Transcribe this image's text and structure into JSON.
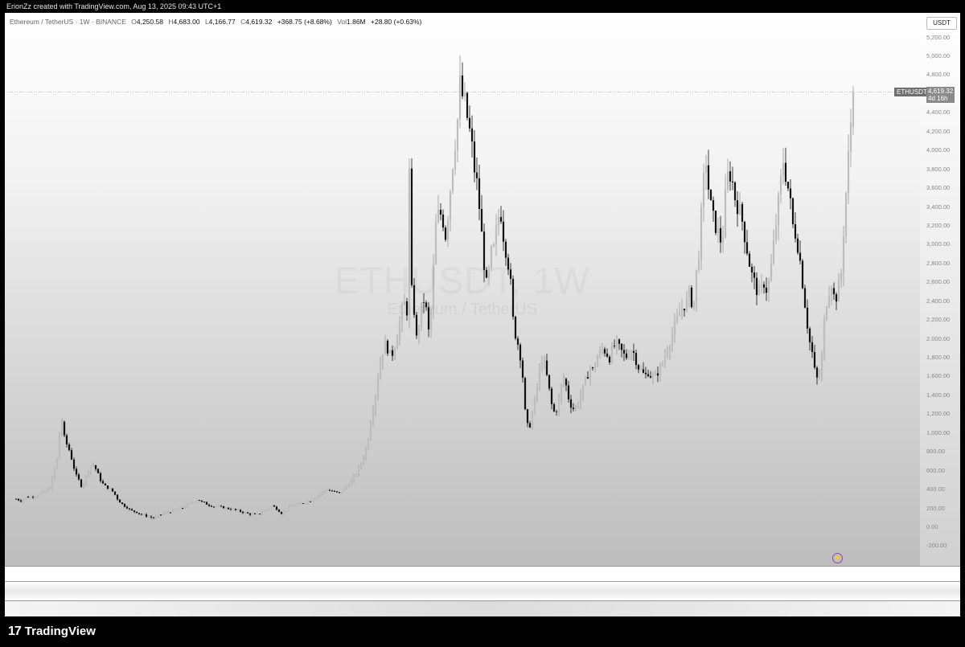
{
  "header": {
    "caption": "ErionZz created with TradingView.com, Aug 13, 2025 09:43 UTC+1"
  },
  "legend": {
    "symbol": "Ethereum / TetherUS · 1W · BINANCE",
    "o_label": "O",
    "o": "4,250.58",
    "h_label": "H",
    "h": "4,683.00",
    "l_label": "L",
    "l": "4,166.77",
    "c_label": "C",
    "c": "4,619.32",
    "change": "+368.75 (+8.68%)",
    "vol_label": "Vol",
    "vol": "1.86M",
    "vol_change": "+28.80 (+0.63%)"
  },
  "watermark": {
    "line1": "ETHUSDT, 1W",
    "line2": "Ethereum / TetherUS"
  },
  "price_scale": {
    "unit": "USDT",
    "ticks": [
      "5,200.00",
      "5,000.00",
      "4,800.00",
      "4,400.00",
      "4,200.00",
      "4,000.00",
      "3,800.00",
      "3,600.00",
      "3,400.00",
      "3,200.00",
      "3,000.00",
      "2,800.00",
      "2,600.00",
      "2,400.00",
      "2,200.00",
      "2,000.00",
      "1,800.00",
      "1,600.00",
      "1,400.00",
      "1,200.00",
      "1,000.00",
      "800.00",
      "600.00",
      "400.00",
      "200.00",
      "0.00",
      "-200.00"
    ],
    "current_symbol": "ETHUSDT",
    "current_price": "4,619.32",
    "countdown": "4d 16h"
  },
  "branding": {
    "logo": "17",
    "name": "TradingView"
  },
  "chart_data": {
    "type": "candlestick",
    "symbol": "ETHUSDT",
    "interval": "1W",
    "ylim": [
      -200,
      5300
    ],
    "last": {
      "open": 4250.58,
      "high": 4683.0,
      "low": 4166.77,
      "close": 4619.32
    },
    "price_path": [
      [
        0,
        300
      ],
      [
        6,
        280
      ],
      [
        12,
        320
      ],
      [
        18,
        320
      ],
      [
        24,
        330
      ],
      [
        30,
        350
      ],
      [
        36,
        380
      ],
      [
        42,
        420
      ],
      [
        48,
        620
      ],
      [
        52,
        760
      ],
      [
        56,
        1250
      ],
      [
        58,
        1000
      ],
      [
        62,
        900
      ],
      [
        66,
        820
      ],
      [
        70,
        700
      ],
      [
        74,
        560
      ],
      [
        78,
        500
      ],
      [
        82,
        420
      ],
      [
        86,
        520
      ],
      [
        90,
        600
      ],
      [
        94,
        680
      ],
      [
        98,
        640
      ],
      [
        102,
        560
      ],
      [
        106,
        480
      ],
      [
        110,
        440
      ],
      [
        114,
        420
      ],
      [
        118,
        400
      ],
      [
        122,
        360
      ],
      [
        126,
        300
      ],
      [
        130,
        260
      ],
      [
        134,
        230
      ],
      [
        138,
        210
      ],
      [
        142,
        180
      ],
      [
        146,
        170
      ],
      [
        150,
        160
      ],
      [
        154,
        140
      ],
      [
        158,
        130
      ],
      [
        162,
        120
      ],
      [
        166,
        110
      ],
      [
        170,
        100
      ],
      [
        174,
        110
      ],
      [
        178,
        130
      ],
      [
        182,
        140
      ],
      [
        186,
        150
      ],
      [
        190,
        160
      ],
      [
        194,
        170
      ],
      [
        198,
        180
      ],
      [
        202,
        190
      ],
      [
        206,
        200
      ],
      [
        210,
        220
      ],
      [
        214,
        240
      ],
      [
        218,
        260
      ],
      [
        222,
        280
      ],
      [
        226,
        300
      ],
      [
        230,
        270
      ],
      [
        234,
        260
      ],
      [
        238,
        240
      ],
      [
        242,
        230
      ],
      [
        246,
        220
      ],
      [
        250,
        220
      ],
      [
        254,
        215
      ],
      [
        258,
        210
      ],
      [
        262,
        200
      ],
      [
        266,
        195
      ],
      [
        270,
        190
      ],
      [
        274,
        180
      ],
      [
        278,
        170
      ],
      [
        282,
        160
      ],
      [
        286,
        150
      ],
      [
        290,
        140
      ],
      [
        294,
        140
      ],
      [
        298,
        130
      ],
      [
        302,
        140
      ],
      [
        306,
        160
      ],
      [
        310,
        180
      ],
      [
        314,
        200
      ],
      [
        318,
        230
      ],
      [
        322,
        210
      ],
      [
        326,
        180
      ],
      [
        330,
        150
      ],
      [
        334,
        170
      ],
      [
        338,
        200
      ],
      [
        342,
        220
      ],
      [
        346,
        230
      ],
      [
        350,
        240
      ],
      [
        354,
        250
      ],
      [
        358,
        260
      ],
      [
        362,
        270
      ],
      [
        366,
        280
      ],
      [
        370,
        300
      ],
      [
        374,
        330
      ],
      [
        378,
        350
      ],
      [
        382,
        380
      ],
      [
        386,
        400
      ],
      [
        390,
        390
      ],
      [
        394,
        380
      ],
      [
        398,
        370
      ],
      [
        402,
        360
      ],
      [
        406,
        390
      ],
      [
        410,
        420
      ],
      [
        414,
        460
      ],
      [
        418,
        500
      ],
      [
        422,
        560
      ],
      [
        426,
        620
      ],
      [
        430,
        700
      ],
      [
        434,
        800
      ],
      [
        438,
        950
      ],
      [
        442,
        1200
      ],
      [
        446,
        1350
      ],
      [
        450,
        1600
      ],
      [
        454,
        1800
      ],
      [
        458,
        1950
      ],
      [
        462,
        1900
      ],
      [
        466,
        1800
      ],
      [
        470,
        1900
      ],
      [
        474,
        2050
      ],
      [
        478,
        2200
      ],
      [
        482,
        2400
      ],
      [
        486,
        2300
      ],
      [
        488,
        3500
      ],
      [
        490,
        4000
      ],
      [
        492,
        2500
      ],
      [
        494,
        2400
      ],
      [
        498,
        2000
      ],
      [
        502,
        2200
      ],
      [
        506,
        2450
      ],
      [
        510,
        2300
      ],
      [
        514,
        2000
      ],
      [
        518,
        2600
      ],
      [
        522,
        3200
      ],
      [
        526,
        3350
      ],
      [
        530,
        3300
      ],
      [
        534,
        3100
      ],
      [
        538,
        3400
      ],
      [
        542,
        3800
      ],
      [
        546,
        4100
      ],
      [
        550,
        4400
      ],
      [
        552,
        4700
      ],
      [
        554,
        4600
      ],
      [
        558,
        4500
      ],
      [
        562,
        4300
      ],
      [
        566,
        4100
      ],
      [
        570,
        3800
      ],
      [
        574,
        3600
      ],
      [
        578,
        3200
      ],
      [
        582,
        2800
      ],
      [
        586,
        2500
      ],
      [
        590,
        2900
      ],
      [
        594,
        2950
      ],
      [
        598,
        3200
      ],
      [
        602,
        3400
      ],
      [
        606,
        3100
      ],
      [
        610,
        2900
      ],
      [
        614,
        2700
      ],
      [
        618,
        2200
      ],
      [
        622,
        2000
      ],
      [
        626,
        1900
      ],
      [
        630,
        1600
      ],
      [
        634,
        1100
      ],
      [
        638,
        1050
      ],
      [
        642,
        1200
      ],
      [
        646,
        1400
      ],
      [
        650,
        1600
      ],
      [
        654,
        1800
      ],
      [
        658,
        1700
      ],
      [
        662,
        1500
      ],
      [
        666,
        1300
      ],
      [
        670,
        1200
      ],
      [
        674,
        1300
      ],
      [
        678,
        1500
      ],
      [
        682,
        1600
      ],
      [
        686,
        1400
      ],
      [
        690,
        1300
      ],
      [
        694,
        1250
      ],
      [
        698,
        1300
      ],
      [
        702,
        1400
      ],
      [
        706,
        1500
      ],
      [
        710,
        1600
      ],
      [
        714,
        1700
      ],
      [
        718,
        1650
      ],
      [
        722,
        1800
      ],
      [
        726,
        1850
      ],
      [
        730,
        1900
      ],
      [
        734,
        1850
      ],
      [
        738,
        1800
      ],
      [
        742,
        1900
      ],
      [
        746,
        1950
      ],
      [
        750,
        1900
      ],
      [
        754,
        1850
      ],
      [
        758,
        1800
      ],
      [
        762,
        1850
      ],
      [
        766,
        1900
      ],
      [
        770,
        1800
      ],
      [
        774,
        1700
      ],
      [
        778,
        1650
      ],
      [
        782,
        1600
      ],
      [
        786,
        1650
      ],
      [
        790,
        1600
      ],
      [
        794,
        1580
      ],
      [
        798,
        1650
      ],
      [
        802,
        1700
      ],
      [
        806,
        1800
      ],
      [
        810,
        1900
      ],
      [
        814,
        2000
      ],
      [
        818,
        2100
      ],
      [
        822,
        2200
      ],
      [
        826,
        2300
      ],
      [
        830,
        2350
      ],
      [
        834,
        2400
      ],
      [
        838,
        2500
      ],
      [
        842,
        2300
      ],
      [
        846,
        2700
      ],
      [
        850,
        3000
      ],
      [
        854,
        3600
      ],
      [
        858,
        3900
      ],
      [
        862,
        3500
      ],
      [
        866,
        3300
      ],
      [
        870,
        3200
      ],
      [
        874,
        3100
      ],
      [
        878,
        3000
      ],
      [
        882,
        3500
      ],
      [
        886,
        3800
      ],
      [
        890,
        3700
      ],
      [
        894,
        3500
      ],
      [
        898,
        3400
      ],
      [
        902,
        3300
      ],
      [
        906,
        3100
      ],
      [
        910,
        2900
      ],
      [
        914,
        2700
      ],
      [
        918,
        2600
      ],
      [
        922,
        2500
      ],
      [
        926,
        2500
      ],
      [
        930,
        2600
      ],
      [
        934,
        2500
      ],
      [
        938,
        2700
      ],
      [
        942,
        3000
      ],
      [
        946,
        3300
      ],
      [
        950,
        3600
      ],
      [
        954,
        3900
      ],
      [
        958,
        3700
      ],
      [
        962,
        3500
      ],
      [
        966,
        3200
      ],
      [
        970,
        3100
      ],
      [
        974,
        2900
      ],
      [
        978,
        2600
      ],
      [
        982,
        2300
      ],
      [
        986,
        2000
      ],
      [
        990,
        1850
      ],
      [
        994,
        1600
      ],
      [
        998,
        1550
      ],
      [
        1002,
        1800
      ],
      [
        1006,
        2300
      ],
      [
        1010,
        2500
      ],
      [
        1014,
        2600
      ],
      [
        1018,
        2400
      ],
      [
        1022,
        2500
      ],
      [
        1026,
        2700
      ],
      [
        1030,
        3300
      ],
      [
        1034,
        3800
      ],
      [
        1038,
        4300
      ],
      [
        1042,
        4619
      ]
    ]
  }
}
